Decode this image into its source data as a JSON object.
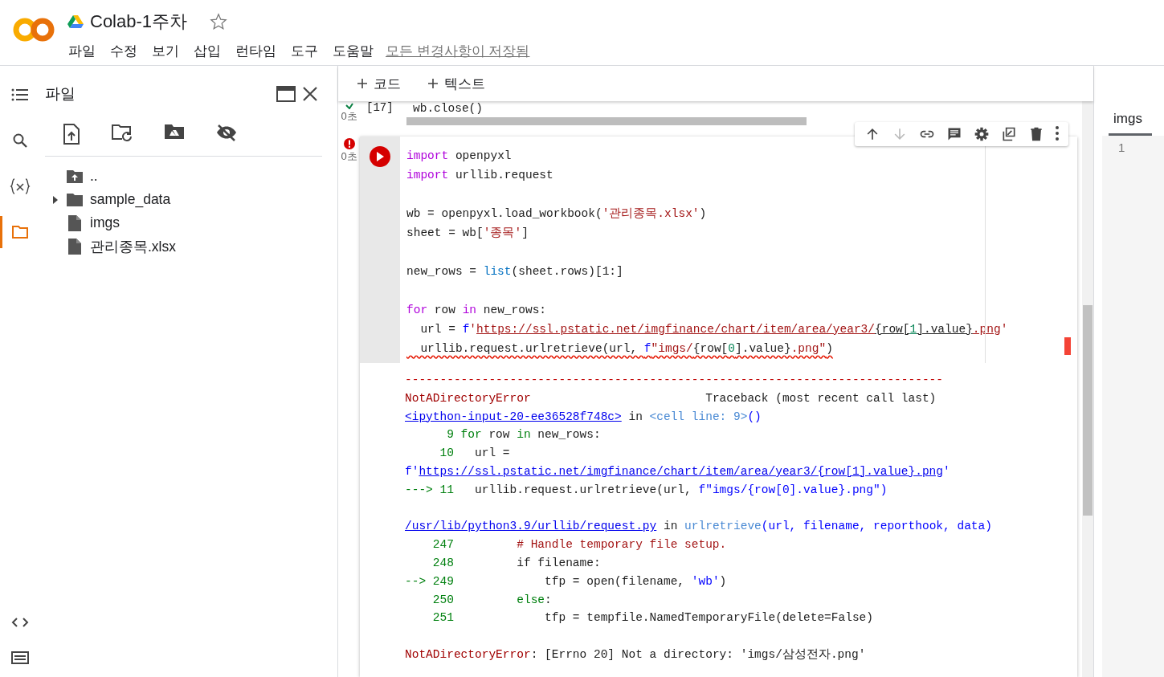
{
  "header": {
    "title": "Colab-1주차",
    "starred": false,
    "menu": [
      "파일",
      "수정",
      "보기",
      "삽입",
      "런타임",
      "도구",
      "도움말"
    ],
    "save_status": "모든 변경사항이 저장됨"
  },
  "rail": {
    "items": [
      {
        "kind": "toc",
        "selected": false
      },
      {
        "kind": "search",
        "selected": false
      },
      {
        "kind": "variables",
        "selected": false
      },
      {
        "kind": "files",
        "selected": true
      }
    ],
    "bottom": [
      {
        "kind": "code"
      },
      {
        "kind": "terminal"
      }
    ]
  },
  "file_panel": {
    "title": "파일",
    "tree": [
      {
        "kind": "parent",
        "name": ".."
      },
      {
        "kind": "folder",
        "name": "sample_data",
        "expanded": false
      },
      {
        "kind": "file",
        "name": "imgs"
      },
      {
        "kind": "file",
        "name": "관리종목.xlsx"
      }
    ]
  },
  "notebook": {
    "toolbar": [
      "코드",
      "텍스트"
    ],
    "cells": [
      {
        "error": false,
        "exec_count": "[17]",
        "time": "0초",
        "focused": false,
        "blocks": [
          [
            {
              "squiggle": false,
              "segs": [
                {
                  "kind": "plain",
                  "text": "wb.close()"
                }
              ]
            }
          ]
        ]
      },
      {
        "error": true,
        "time": "0초",
        "focused": true,
        "blocks": [
          [
            {
              "squiggle": false,
              "segs": [
                {
                  "kind": "kw",
                  "text": "import"
                },
                {
                  "kind": "plain",
                  "text": " openpyxl"
                }
              ]
            },
            {
              "squiggle": false,
              "segs": [
                {
                  "kind": "kw",
                  "text": "import"
                },
                {
                  "kind": "plain",
                  "text": " urllib.request"
                }
              ]
            }
          ],
          [
            {
              "squiggle": false,
              "segs": [
                {
                  "kind": "plain",
                  "text": "wb = openpyxl.load_workbook("
                },
                {
                  "kind": "str",
                  "text": "'관리종목.xlsx'"
                },
                {
                  "kind": "plain",
                  "text": ")"
                }
              ]
            },
            {
              "squiggle": false,
              "segs": [
                {
                  "kind": "plain",
                  "text": "sheet = wb["
                },
                {
                  "kind": "str",
                  "text": "'종목'"
                },
                {
                  "kind": "plain",
                  "text": "]"
                }
              ]
            }
          ],
          [
            {
              "squiggle": false,
              "segs": [
                {
                  "kind": "plain",
                  "text": "new_rows = "
                },
                {
                  "kind": "builtin",
                  "text": "list"
                },
                {
                  "kind": "plain",
                  "text": "(sheet.rows)[1:]"
                }
              ]
            }
          ],
          [
            {
              "squiggle": false,
              "segs": [
                {
                  "kind": "kw",
                  "text": "for"
                },
                {
                  "kind": "plain",
                  "text": " row "
                },
                {
                  "kind": "kw",
                  "text": "in"
                },
                {
                  "kind": "plain",
                  "text": " new_rows:"
                }
              ]
            },
            {
              "squiggle": false,
              "segs": [
                {
                  "kind": "plain",
                  "text": "  url = "
                },
                {
                  "kind": "blue",
                  "text": "f"
                },
                {
                  "kind": "str",
                  "text": "'"
                },
                {
                  "kind": "strlink",
                  "text": "https://ssl.pstatic.net/imgfinance/chart/item/area/year3/"
                },
                {
                  "kind": "plainlink",
                  "text": "{row["
                },
                {
                  "kind": "numlink",
                  "text": "1"
                },
                {
                  "kind": "plainlink",
                  "text": "].value}"
                },
                {
                  "kind": "strlink",
                  "text": ".png"
                },
                {
                  "kind": "str",
                  "text": "'"
                }
              ]
            },
            {
              "squiggle": true,
              "segs": [
                {
                  "kind": "plain",
                  "text": "  urllib.request.urlretrieve(url, "
                },
                {
                  "kind": "blue",
                  "text": "f"
                },
                {
                  "kind": "str",
                  "text": "\"imgs/"
                },
                {
                  "kind": "plain",
                  "text": "{row["
                },
                {
                  "kind": "num",
                  "text": "0"
                },
                {
                  "kind": "plain",
                  "text": "].value}"
                },
                {
                  "kind": "str",
                  "text": ".png\""
                },
                {
                  "kind": "plain",
                  "text": ")"
                }
              ]
            }
          ]
        ],
        "output": [
          [
            [
              {
                "kind": "err",
                "text": "-----------------------------------------------------------------------------"
              }
            ],
            [
              {
                "kind": "errname",
                "text": "NotADirectoryError"
              },
              {
                "kind": "plain",
                "text": "                         Traceback (most recent call last)"
              }
            ],
            [
              {
                "kind": "link",
                "text": "<ipython-input-20-ee36528f748c>"
              },
              {
                "kind": "plain",
                "text": " in "
              },
              {
                "kind": "cyan",
                "text": "<cell line: 9>"
              },
              {
                "kind": "blue",
                "text": "()"
              }
            ],
            [
              {
                "kind": "green",
                "text": "      9 for"
              },
              {
                "kind": "plain",
                "text": " row "
              },
              {
                "kind": "green",
                "text": "in"
              },
              {
                "kind": "plain",
                "text": " new_rows:"
              }
            ],
            [
              {
                "kind": "green",
                "text": "     10"
              },
              {
                "kind": "plain",
                "text": "   url ="
              }
            ],
            [
              {
                "kind": "blue",
                "text": "f'"
              },
              {
                "kind": "link",
                "text": "https://ssl.pstatic.net/imgfinance/chart/item/area/year3/{row[1].value}.png"
              },
              {
                "kind": "blue",
                "text": "'"
              }
            ],
            [
              {
                "kind": "green",
                "text": "---> 11"
              },
              {
                "kind": "plain",
                "text": "   urllib.request.urlretrieve(url, "
              },
              {
                "kind": "blue",
                "text": "f\"imgs/{row[0].value}.png\")"
              }
            ]
          ],
          [
            [
              {
                "kind": "link",
                "text": "/usr/lib/python3.9/urllib/request.py"
              },
              {
                "kind": "plain",
                "text": " in "
              },
              {
                "kind": "cyan",
                "text": "urlretrieve"
              },
              {
                "kind": "blue",
                "text": "(url, filename, reporthook, data)"
              }
            ],
            [
              {
                "kind": "green",
                "text": "    247"
              },
              {
                "kind": "comment",
                "text": "         # Handle temporary file setup."
              }
            ],
            [
              {
                "kind": "green",
                "text": "    248"
              },
              {
                "kind": "plain",
                "text": "         if filename:"
              }
            ],
            [
              {
                "kind": "green",
                "text": "--> 249"
              },
              {
                "kind": "plain",
                "text": "             tfp = open(filename, "
              },
              {
                "kind": "blue",
                "text": "'wb'"
              },
              {
                "kind": "plain",
                "text": ")"
              }
            ],
            [
              {
                "kind": "green",
                "text": "    250"
              },
              {
                "kind": "green",
                "text": "         else"
              },
              {
                "kind": "plain",
                "text": ":"
              }
            ],
            [
              {
                "kind": "green",
                "text": "    251"
              },
              {
                "kind": "plain",
                "text": "             tfp = tempfile.NamedTemporaryFile(delete=False)"
              }
            ]
          ],
          [
            [
              {
                "kind": "errname",
                "text": "NotADirectoryError"
              },
              {
                "kind": "plain",
                "text": ": [Errno 20] Not a directory: 'imgs/삼성전자.png'"
              }
            ]
          ]
        ]
      }
    ]
  },
  "editor": {
    "tab": "imgs",
    "line_numbers": [
      "1"
    ]
  }
}
